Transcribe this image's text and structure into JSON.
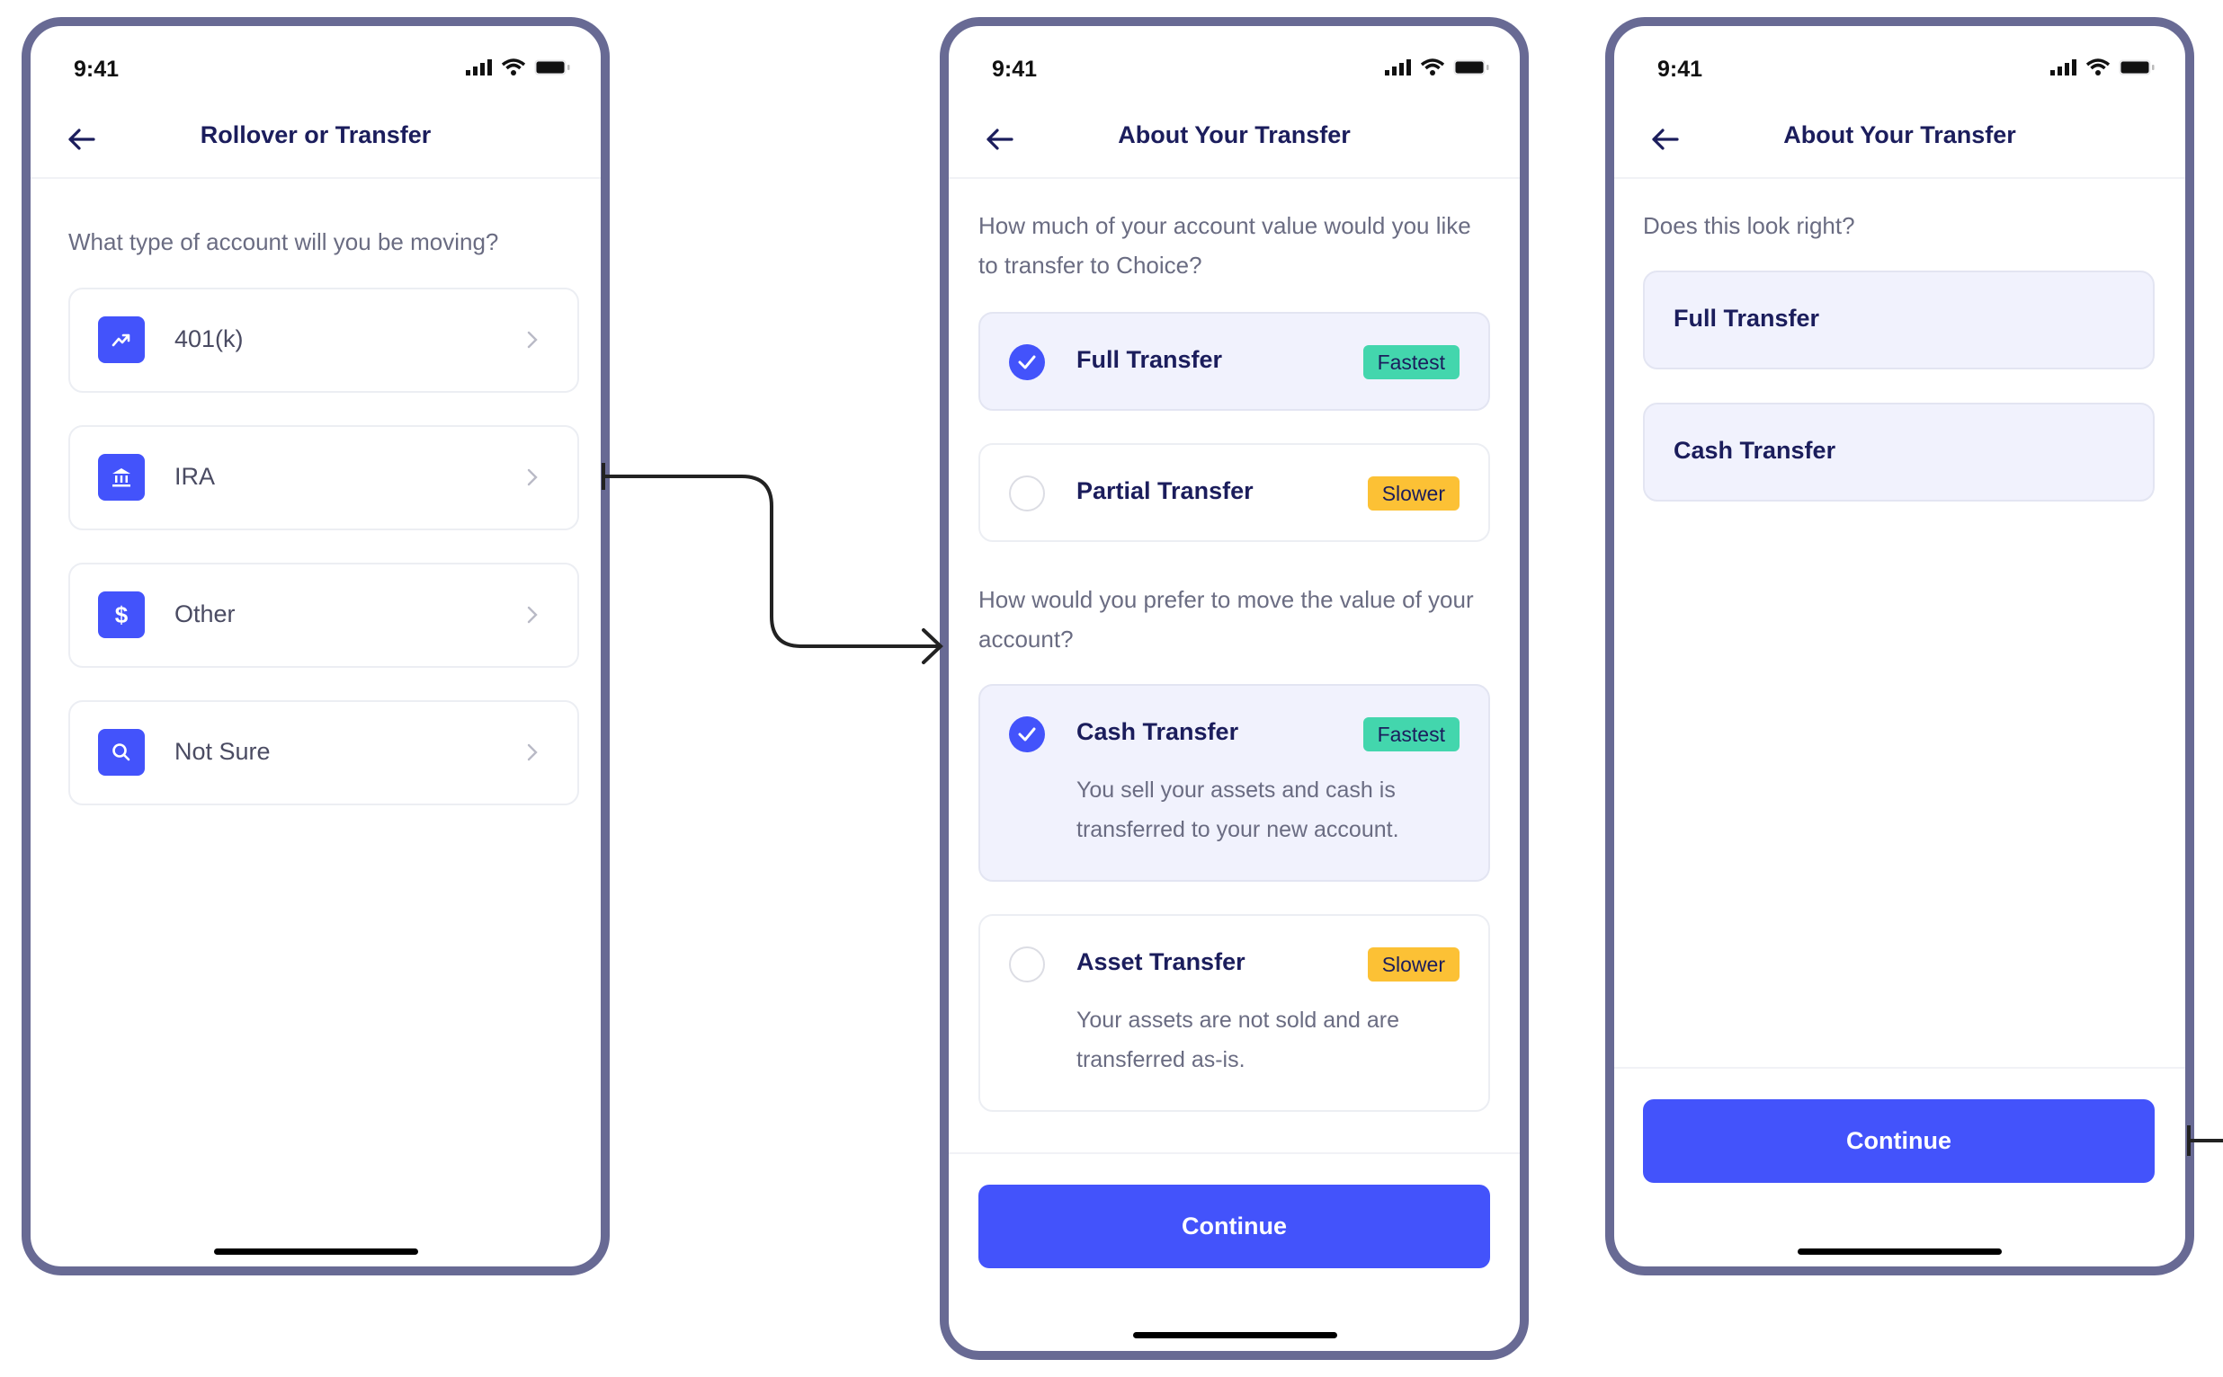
{
  "status_bar": {
    "time": "9:41"
  },
  "screens": [
    {
      "title": "Rollover or Transfer",
      "question": "What type of account will you be moving?",
      "options": [
        {
          "label": "401(k)",
          "icon": "trending-up-icon"
        },
        {
          "label": "IRA",
          "icon": "bank-icon"
        },
        {
          "label": "Other",
          "icon": "dollar-icon"
        },
        {
          "label": "Not Sure",
          "icon": "search-icon"
        }
      ]
    },
    {
      "title": "About Your Transfer",
      "question_amount": "How much of your account value would you like to transfer to Choice?",
      "amount_options": [
        {
          "title": "Full Transfer",
          "badge": "Fastest",
          "selected": true
        },
        {
          "title": "Partial Transfer",
          "badge": "Slower",
          "selected": false
        }
      ],
      "question_method": "How would you prefer to move the value of your account?",
      "method_options": [
        {
          "title": "Cash Transfer",
          "badge": "Fastest",
          "description": "You sell your assets and cash is transferred to your new account.",
          "selected": true
        },
        {
          "title": "Asset Transfer",
          "badge": "Slower",
          "description": "Your assets are not sold and are transferred as-is.",
          "selected": false
        }
      ],
      "continue_label": "Continue"
    },
    {
      "title": "About Your Transfer",
      "question": "Does this look right?",
      "summary": [
        "Full Transfer",
        "Cash Transfer"
      ],
      "continue_label": "Continue"
    }
  ],
  "colors": {
    "primary": "#4353fb",
    "fastest_badge": "#43d6ad",
    "slower_badge": "#fcc135",
    "frame": "#686a94",
    "heading": "#1b1d5c"
  }
}
